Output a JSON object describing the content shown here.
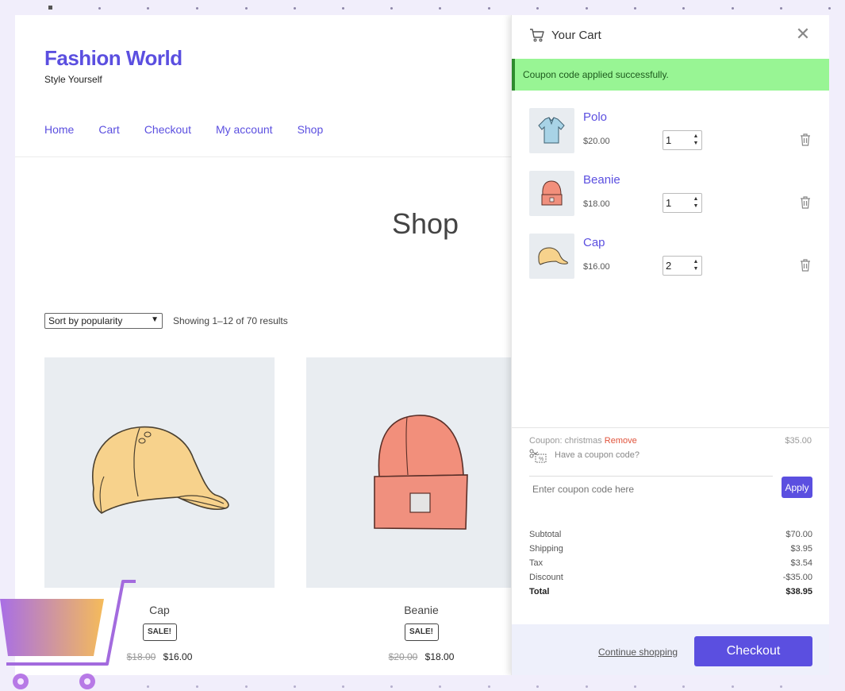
{
  "site": {
    "title": "Fashion World",
    "tagline": "Style Yourself"
  },
  "nav": [
    "Home",
    "Cart",
    "Checkout",
    "My account",
    "Shop"
  ],
  "shop": {
    "heading": "Shop",
    "sort_selected": "Sort by popularity",
    "results_count": "Showing 1–12 of 70 results",
    "products": [
      {
        "name": "Cap",
        "badge": "SALE!",
        "old_price": "$18.00",
        "price": "$16.00"
      },
      {
        "name": "Beanie",
        "badge": "SALE!",
        "old_price": "$20.00",
        "price": "$18.00"
      }
    ]
  },
  "cart": {
    "title": "Your Cart",
    "notice": "Coupon code applied successfully.",
    "items": [
      {
        "name": "Polo",
        "price": "$20.00",
        "qty": "1"
      },
      {
        "name": "Beanie",
        "price": "$18.00",
        "qty": "1"
      },
      {
        "name": "Cap",
        "price": "$16.00",
        "qty": "2"
      }
    ],
    "coupon": {
      "label": "Coupon: christmas",
      "remove_label": "Remove",
      "amount": "$35.00",
      "prompt": "Have a coupon code?",
      "placeholder": "Enter coupon code here",
      "apply_label": "Apply"
    },
    "totals": {
      "subtotal_label": "Subtotal",
      "subtotal": "$70.00",
      "shipping_label": "Shipping",
      "shipping": "$3.95",
      "tax_label": "Tax",
      "tax": "$3.54",
      "discount_label": "Discount",
      "discount": "-$35.00",
      "total_label": "Total",
      "total": "$38.95"
    },
    "continue_label": "Continue shopping",
    "checkout_label": "Checkout"
  },
  "colors": {
    "accent": "#5b4fe0",
    "notice_bg": "#98f594",
    "remove": "#e0533b"
  }
}
